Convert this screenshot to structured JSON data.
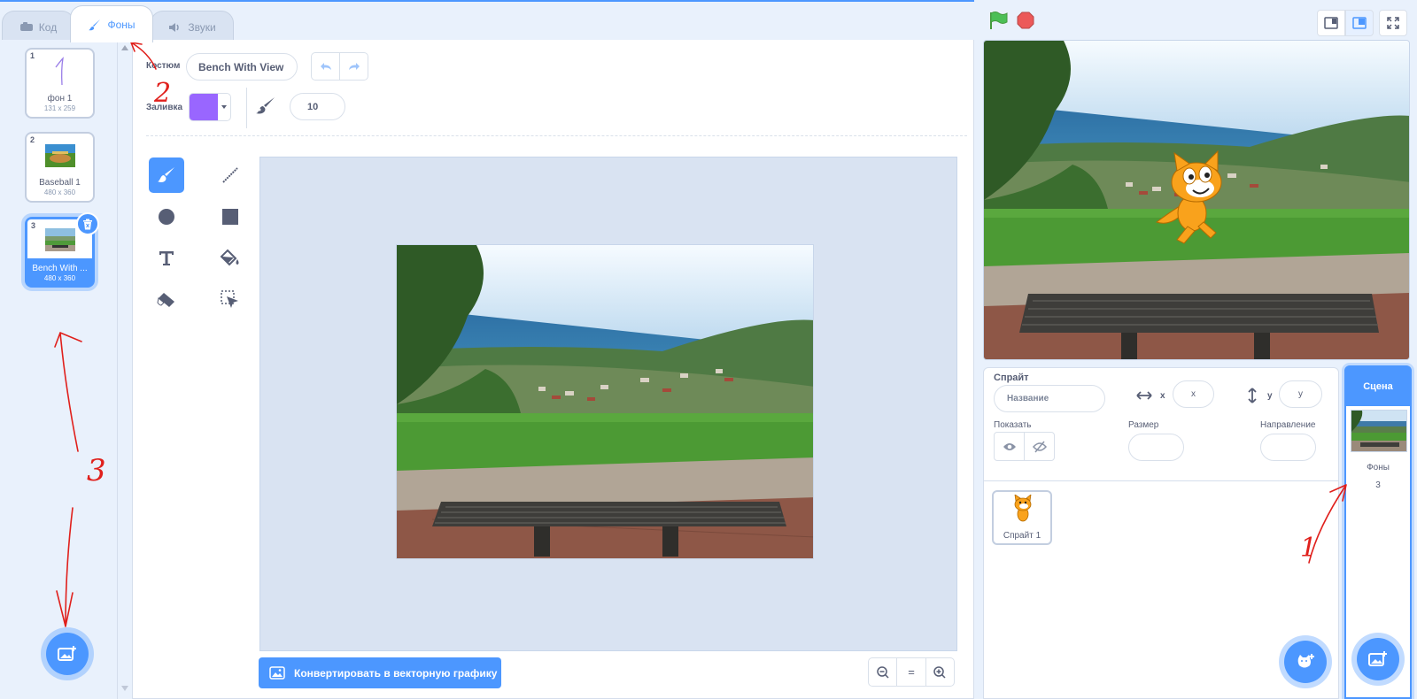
{
  "tabs": [
    {
      "label": "Код",
      "icon": "code-icon"
    },
    {
      "label": "Фоны",
      "icon": "brush-icon"
    },
    {
      "label": "Звуки",
      "icon": "speaker-icon"
    }
  ],
  "costumes": [
    {
      "num": "1",
      "name": "фон 1",
      "size": "131 x 259"
    },
    {
      "num": "2",
      "name": "Baseball 1",
      "size": "480 x 360"
    },
    {
      "num": "3",
      "name": "Bench With ...",
      "size": "480 x 360"
    }
  ],
  "editor": {
    "costume_label": "Костюм",
    "costume_name": "Bench With View",
    "fill_label": "Заливка",
    "fill_color": "#9966ff",
    "brush_size": "10",
    "convert_button": "Конвертировать в векторную графику",
    "zoom_reset": "="
  },
  "sprite": {
    "title": "Спрайт",
    "name_placeholder": "Название",
    "x_label": "x",
    "x_placeholder": "x",
    "y_label": "y",
    "y_placeholder": "y",
    "show_label": "Показать",
    "size_label": "Размер",
    "direction_label": "Направление",
    "sprites": [
      {
        "name": "Спрайт 1"
      }
    ]
  },
  "scene": {
    "header": "Сцена",
    "backdrops_label": "Фоны",
    "backdrops_count": "3"
  },
  "annotations": [
    "2",
    "3",
    "1"
  ],
  "colors": {
    "accent": "#4c97ff",
    "flag": "#4cbf56",
    "stop": "#ec5959"
  }
}
